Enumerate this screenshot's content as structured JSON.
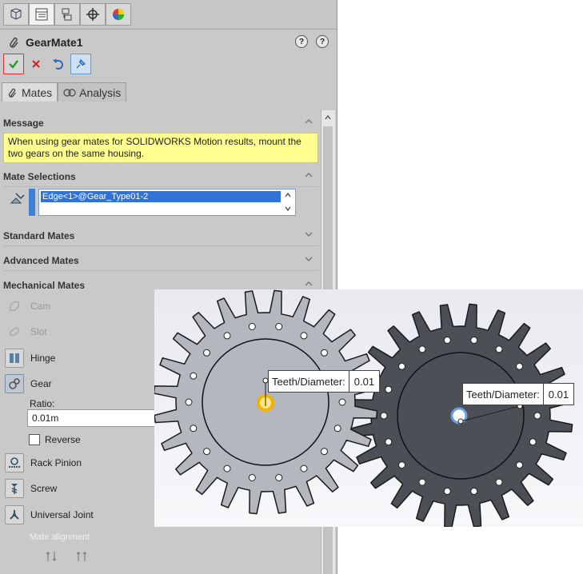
{
  "feature": {
    "title": "GearMate1"
  },
  "top_tabs": [
    {
      "name": "featuremanager-tab-icon"
    },
    {
      "name": "propertymanager-tab-icon"
    },
    {
      "name": "configuration-manager-tab-icon"
    },
    {
      "name": "dimxpert-tab-icon"
    },
    {
      "name": "display-manager-tab-icon"
    }
  ],
  "actions": {
    "ok_icon": "checkmark-icon",
    "cancel_icon": "x-icon",
    "undo_icon": "undo-icon",
    "pin_icon": "pushpin-icon"
  },
  "tabs": {
    "mates": "Mates",
    "analysis": "Analysis"
  },
  "sections": {
    "message": "Message",
    "mate_selections": "Mate Selections",
    "standard_mates": "Standard Mates",
    "advanced_mates": "Advanced Mates",
    "mechanical_mates": "Mechanical Mates"
  },
  "message_text": "When using gear mates for SOLIDWORKS Motion results, mount the two gears on the same housing.",
  "selection": {
    "item": "Edge<1>@Gear_Type01-2"
  },
  "mechanical": {
    "cam": "Cam",
    "slot": "Slot",
    "hinge": "Hinge",
    "gear": "Gear",
    "ratio_label": "Ratio:",
    "ratio_value": "0.01m",
    "reverse": "Reverse",
    "rack_pinion": "Rack Pinion",
    "screw": "Screw",
    "universal_joint": "Universal Joint",
    "mate_alignment": "Mate alignment"
  },
  "callouts": [
    {
      "label": "Teeth/Diameter:",
      "value": "0.01"
    },
    {
      "label": "Teeth/Diameter:",
      "value": "0.01"
    }
  ],
  "colors": {
    "panel_bg": "#c9c9c9",
    "message_bg": "#ffff90",
    "selection_bg": "#2f73d6",
    "gear_light": "#b4b7bd",
    "gear_dark": "#4c4f55",
    "highlight_orange": "#f0b400"
  }
}
